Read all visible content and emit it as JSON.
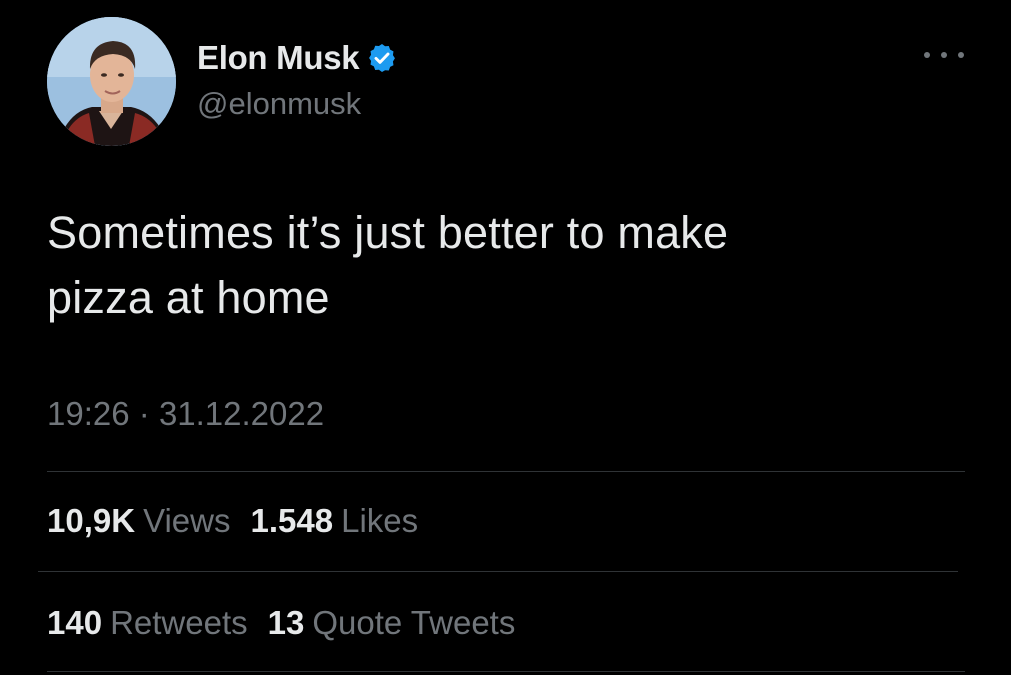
{
  "user": {
    "display_name": "Elon Musk",
    "handle": "@elonmusk",
    "verified_color": "#1d9bf0"
  },
  "tweet": {
    "text": "Sometimes it’s just better to make\npizza at home",
    "time": "19:26",
    "separator": "·",
    "date": "31.12.2022"
  },
  "stats_row_1": [
    {
      "value": "10,9K",
      "label": "Views"
    },
    {
      "value": "1.548",
      "label": "Likes"
    }
  ],
  "stats_row_2": [
    {
      "value": "140",
      "label": "Retweets"
    },
    {
      "value": "13",
      "label": "Quote Tweets"
    }
  ],
  "icons": {
    "verified": "verified-badge-icon",
    "more": "more-options-icon"
  },
  "colors": {
    "background": "#000000",
    "primary_text": "#e7e9ea",
    "secondary_text": "#71767b",
    "divider": "#2f3336",
    "accent": "#1d9bf0"
  }
}
